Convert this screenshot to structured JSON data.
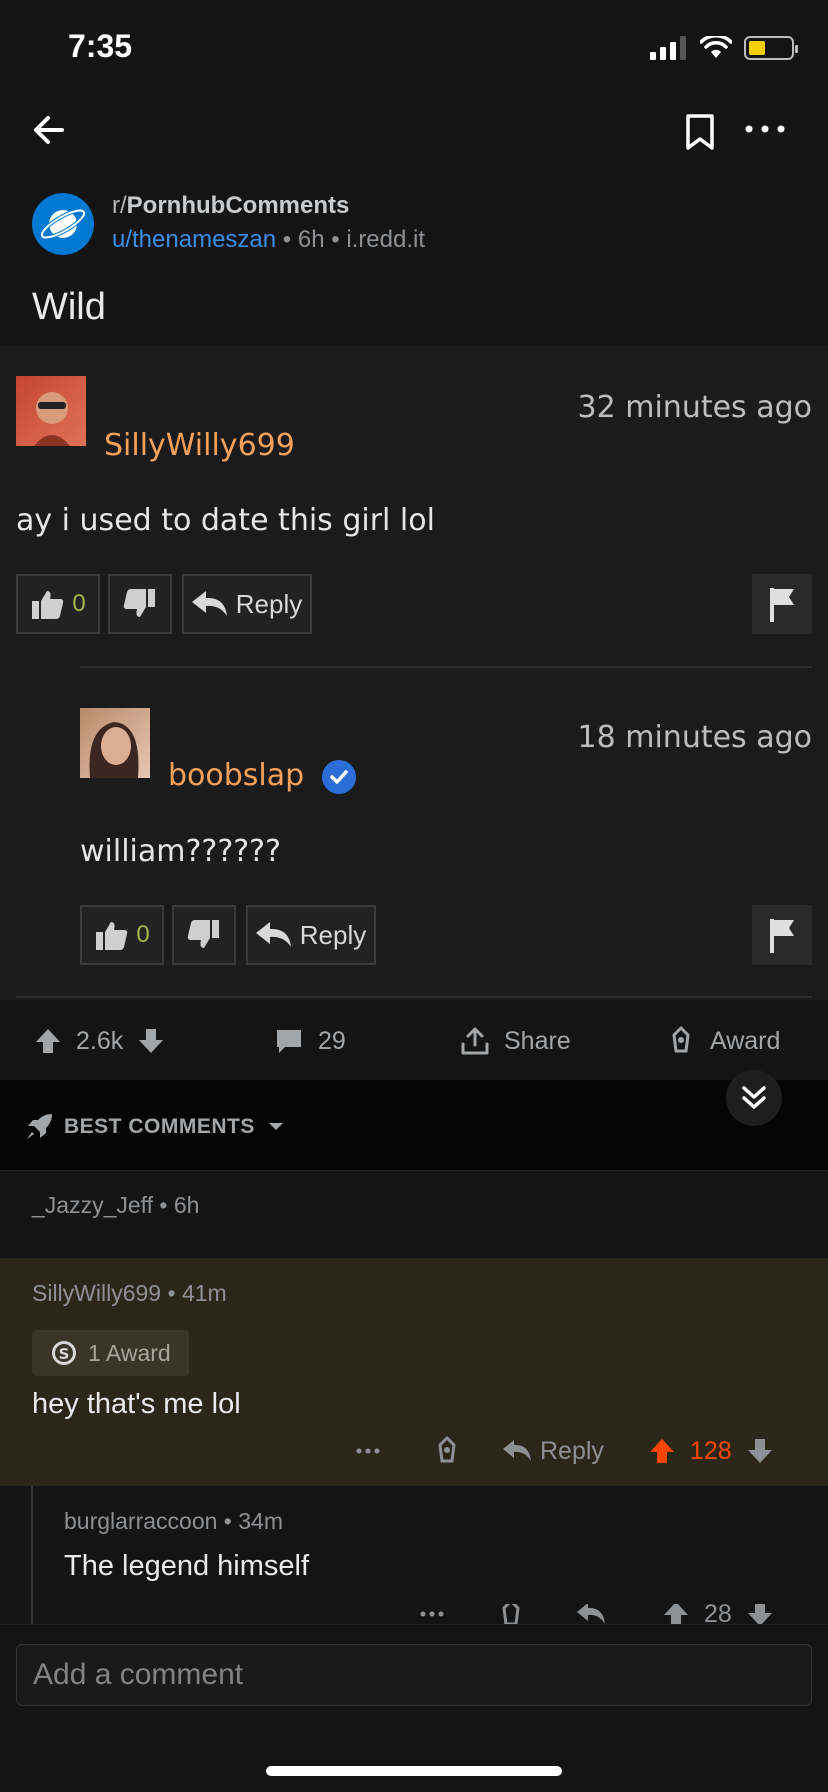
{
  "status_bar": {
    "time": "7:35"
  },
  "post": {
    "subreddit_prefix": "r/",
    "subreddit": "PornhubComments",
    "author": "u/thenameszan",
    "age": "6h",
    "domain": "i.redd.it",
    "title": "Wild"
  },
  "embed": {
    "comment1": {
      "username": "SillyWilly699",
      "time": "32 minutes ago",
      "body": "ay i used to date this girl lol",
      "likes": "0",
      "reply_label": "Reply"
    },
    "comment2": {
      "username": "boobslap",
      "time": "18 minutes ago",
      "body": "william??????",
      "likes": "0",
      "reply_label": "Reply"
    }
  },
  "actions": {
    "score": "2.6k",
    "comments": "29",
    "share": "Share",
    "award": "Award"
  },
  "sort": {
    "label": "BEST COMMENTS"
  },
  "comments": [
    {
      "author": "_Jazzy_Jeff",
      "age": "6h"
    },
    {
      "author": "SillyWilly699",
      "age": "41m",
      "award": "1 Award",
      "body": "hey that's me lol",
      "reply": "Reply",
      "score": "128"
    },
    {
      "author": "burglarraccoon",
      "age": "34m",
      "body": "The legend himself",
      "score": "28"
    }
  ],
  "composer": {
    "placeholder": "Add a comment"
  },
  "colors": {
    "accent_orange": "#ff4500",
    "link_blue": "#3a8ee6",
    "highlight_bg": "#2b2718"
  }
}
